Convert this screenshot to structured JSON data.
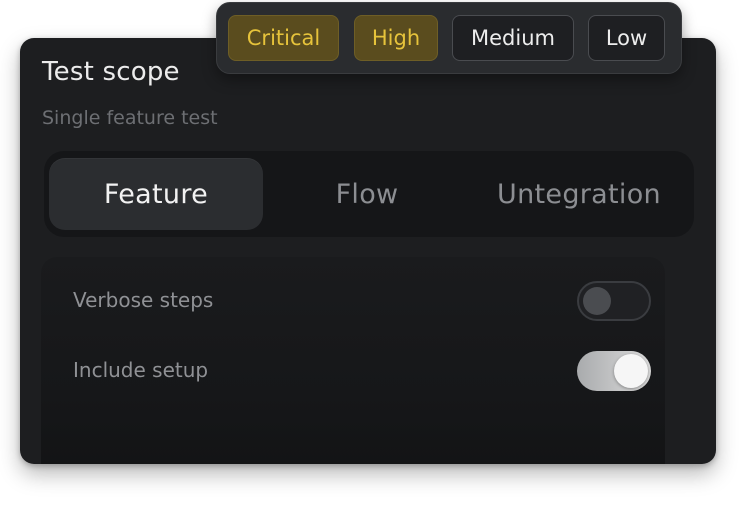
{
  "card": {
    "title": "Test scope",
    "subtitle": "Single feature test"
  },
  "scope_tabs": {
    "items": [
      {
        "label": "Feature",
        "selected": true
      },
      {
        "label": "Flow",
        "selected": false
      },
      {
        "label": "Untegration",
        "selected": false
      }
    ]
  },
  "options": {
    "items": [
      {
        "label": "Verbose steps",
        "enabled": false
      },
      {
        "label": "Include setup",
        "enabled": true
      }
    ]
  },
  "priority": {
    "items": [
      {
        "label": "Critical",
        "selected": true
      },
      {
        "label": "High",
        "selected": true
      },
      {
        "label": "Medium",
        "selected": false
      },
      {
        "label": "Low",
        "selected": false
      }
    ],
    "selected_color": "#e6c33b"
  }
}
